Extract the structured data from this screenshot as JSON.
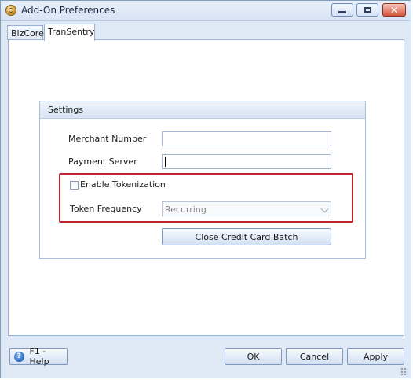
{
  "window": {
    "title": "Add-On Preferences",
    "controls": {
      "minimize": "minimize",
      "maximize": "maximize",
      "close": "✕"
    }
  },
  "tabs": [
    {
      "label": "BizCore",
      "active": false
    },
    {
      "label": "TranSentry",
      "active": true
    }
  ],
  "settings": {
    "title": "Settings",
    "merchant_number": {
      "label": "Merchant Number",
      "value": ""
    },
    "payment_server": {
      "label": "Payment Server",
      "value": ""
    },
    "enable_tokenization": {
      "label": "Enable Tokenization",
      "checked": false
    },
    "token_frequency": {
      "label": "Token Frequency",
      "value": "Recurring",
      "enabled": false
    },
    "close_batch_label": "Close Credit Card Batch"
  },
  "footer": {
    "help_label": "F1 - Help",
    "help_icon_glyph": "?",
    "ok_label": "OK",
    "cancel_label": "Cancel",
    "apply_label": "Apply"
  },
  "colors": {
    "highlight_border": "#c0232c",
    "chrome_background": "#dfe8f5"
  }
}
